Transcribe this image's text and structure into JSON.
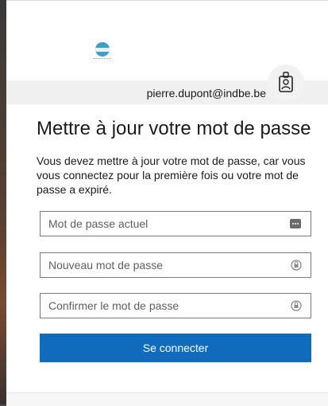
{
  "account": {
    "email": "pierre.dupont@indbe.be"
  },
  "form": {
    "title": "Mettre à jour votre mot de passe",
    "description": "Vous devez mettre à jour votre mot de passe, car vous vous connectez pour la première fois ou votre mot de passe a expiré.",
    "fields": [
      {
        "placeholder": "Mot de passe actuel",
        "icon": "password-manager-icon"
      },
      {
        "placeholder": "Nouveau mot de passe",
        "icon": "password-lock-icon"
      },
      {
        "placeholder": "Confirmer le mot de passe",
        "icon": "password-lock-icon"
      }
    ],
    "submit_label": "Se connecter"
  },
  "colors": {
    "accent": "#0f6cbd",
    "logo": "#3aa0c8"
  }
}
